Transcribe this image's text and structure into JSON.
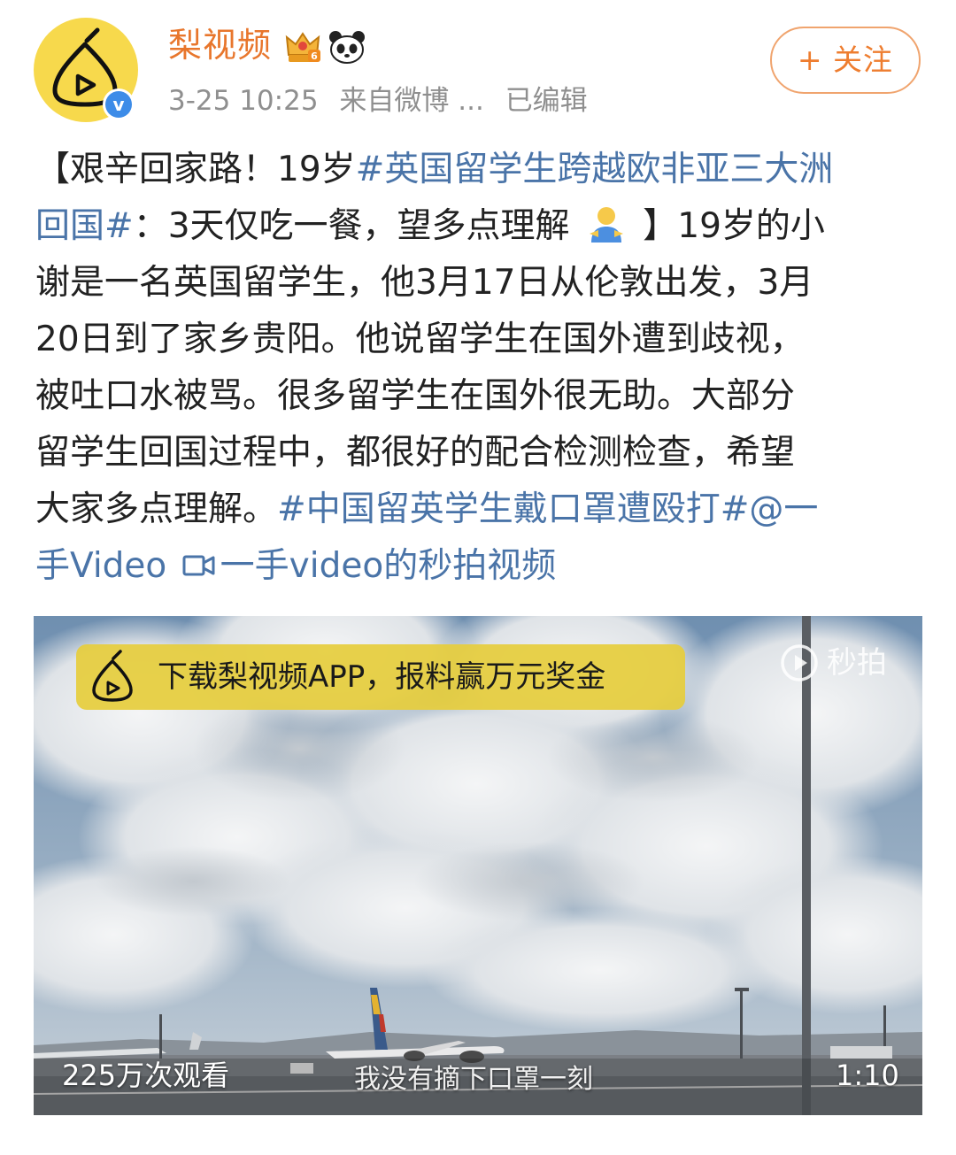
{
  "header": {
    "username": "梨视频",
    "timestamp": "3-25 10:25",
    "source": "来自微博 ...",
    "edited": "已编辑",
    "follow_label": "+ 关注",
    "verified_mark": "v",
    "crown_badge_text": "6"
  },
  "post": {
    "lines": [
      [
        {
          "text": "【艰辛回家路！19岁",
          "tag": false
        },
        {
          "text": "#英国留学生跨越欧非亚三大洲",
          "tag": true
        }
      ],
      [
        {
          "text": "回国#",
          "tag": true
        },
        {
          "text": "：3天仅吃一餐，望多点理解 ",
          "tag": false
        },
        {
          "emoji": "man-emoji"
        },
        {
          "text": " 】19岁的小",
          "tag": false
        }
      ],
      [
        {
          "text": "谢是一名英国留学生，他3月17日从伦敦出发，3月",
          "tag": false
        }
      ],
      [
        {
          "text": "20日到了家乡贵阳。他说留学生在国外遭到歧视，",
          "tag": false
        }
      ],
      [
        {
          "text": "被吐口水被骂。很多留学生在国外很无助。大部分",
          "tag": false
        }
      ],
      [
        {
          "text": "留学生回国过程中，都很好的配合检测检查，希望",
          "tag": false
        }
      ],
      [
        {
          "text": "大家多点理解。",
          "tag": false
        },
        {
          "text": "#中国留英学生戴口罩遭殴打#",
          "tag": true
        },
        {
          "text": "@一",
          "tag": true
        }
      ],
      [
        {
          "text": "手Video ",
          "tag": true
        },
        {
          "icon": "video-camera-icon"
        },
        {
          "text": "一手video的秒拍视频",
          "tag": true
        }
      ]
    ]
  },
  "video": {
    "ad_text": "下载梨视频APP，报料赢万元奖金",
    "watermark": "秒拍",
    "views": "225万次观看",
    "subtitle": "我没有摘下口罩一刻",
    "duration": "1:10"
  },
  "colors": {
    "username": "#e8762c",
    "follow": "#ee7d2f",
    "tag_link": "#4a74a8",
    "meta": "#8f8f8f",
    "text": "#222222",
    "avatar_bg": "#f7d94c",
    "verified": "#3d8ce8"
  }
}
